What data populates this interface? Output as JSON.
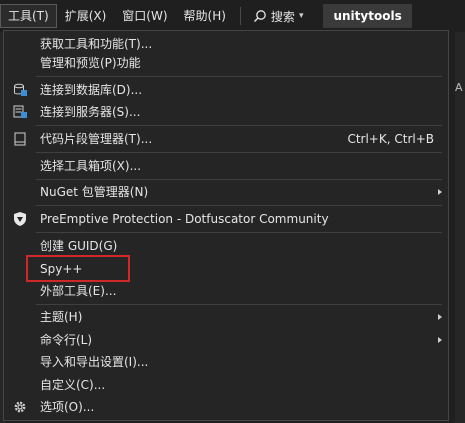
{
  "menubar": {
    "items": [
      "工具(T)",
      "扩展(X)",
      "窗口(W)",
      "帮助(H)"
    ],
    "search_label": "搜索",
    "project_name": "unitytools"
  },
  "background": {
    "right_edge_text": "A"
  },
  "menu": {
    "items": [
      {
        "label": "获取工具和功能(T)..."
      },
      {
        "label": "管理和预览(P)功能"
      },
      {
        "label": "连接到数据库(D)...",
        "icon": "database-connect-icon"
      },
      {
        "label": "连接到服务器(S)...",
        "icon": "server-connect-icon"
      },
      {
        "label": "代码片段管理器(T)...",
        "shortcut": "Ctrl+K, Ctrl+B",
        "icon": "snippet-manager-icon"
      },
      {
        "label": "选择工具箱项(X)..."
      },
      {
        "label": "NuGet 包管理器(N)",
        "submenu": true
      },
      {
        "label": "PreEmptive Protection - Dotfuscator Community",
        "icon": "shield-icon"
      },
      {
        "label": "创建 GUID(G)"
      },
      {
        "label": "Spy++",
        "highlighted": true
      },
      {
        "label": "外部工具(E)..."
      },
      {
        "label": "主题(H)",
        "submenu": true
      },
      {
        "label": "命令行(L)",
        "submenu": true
      },
      {
        "label": "导入和导出设置(I)..."
      },
      {
        "label": "自定义(C)..."
      },
      {
        "label": "选项(O)...",
        "icon": "gear-icon"
      }
    ]
  },
  "colors": {
    "background": "#1f1f1f",
    "menu_background": "#252526",
    "text": "#e6e6e6",
    "highlight_border": "#d1262a"
  }
}
